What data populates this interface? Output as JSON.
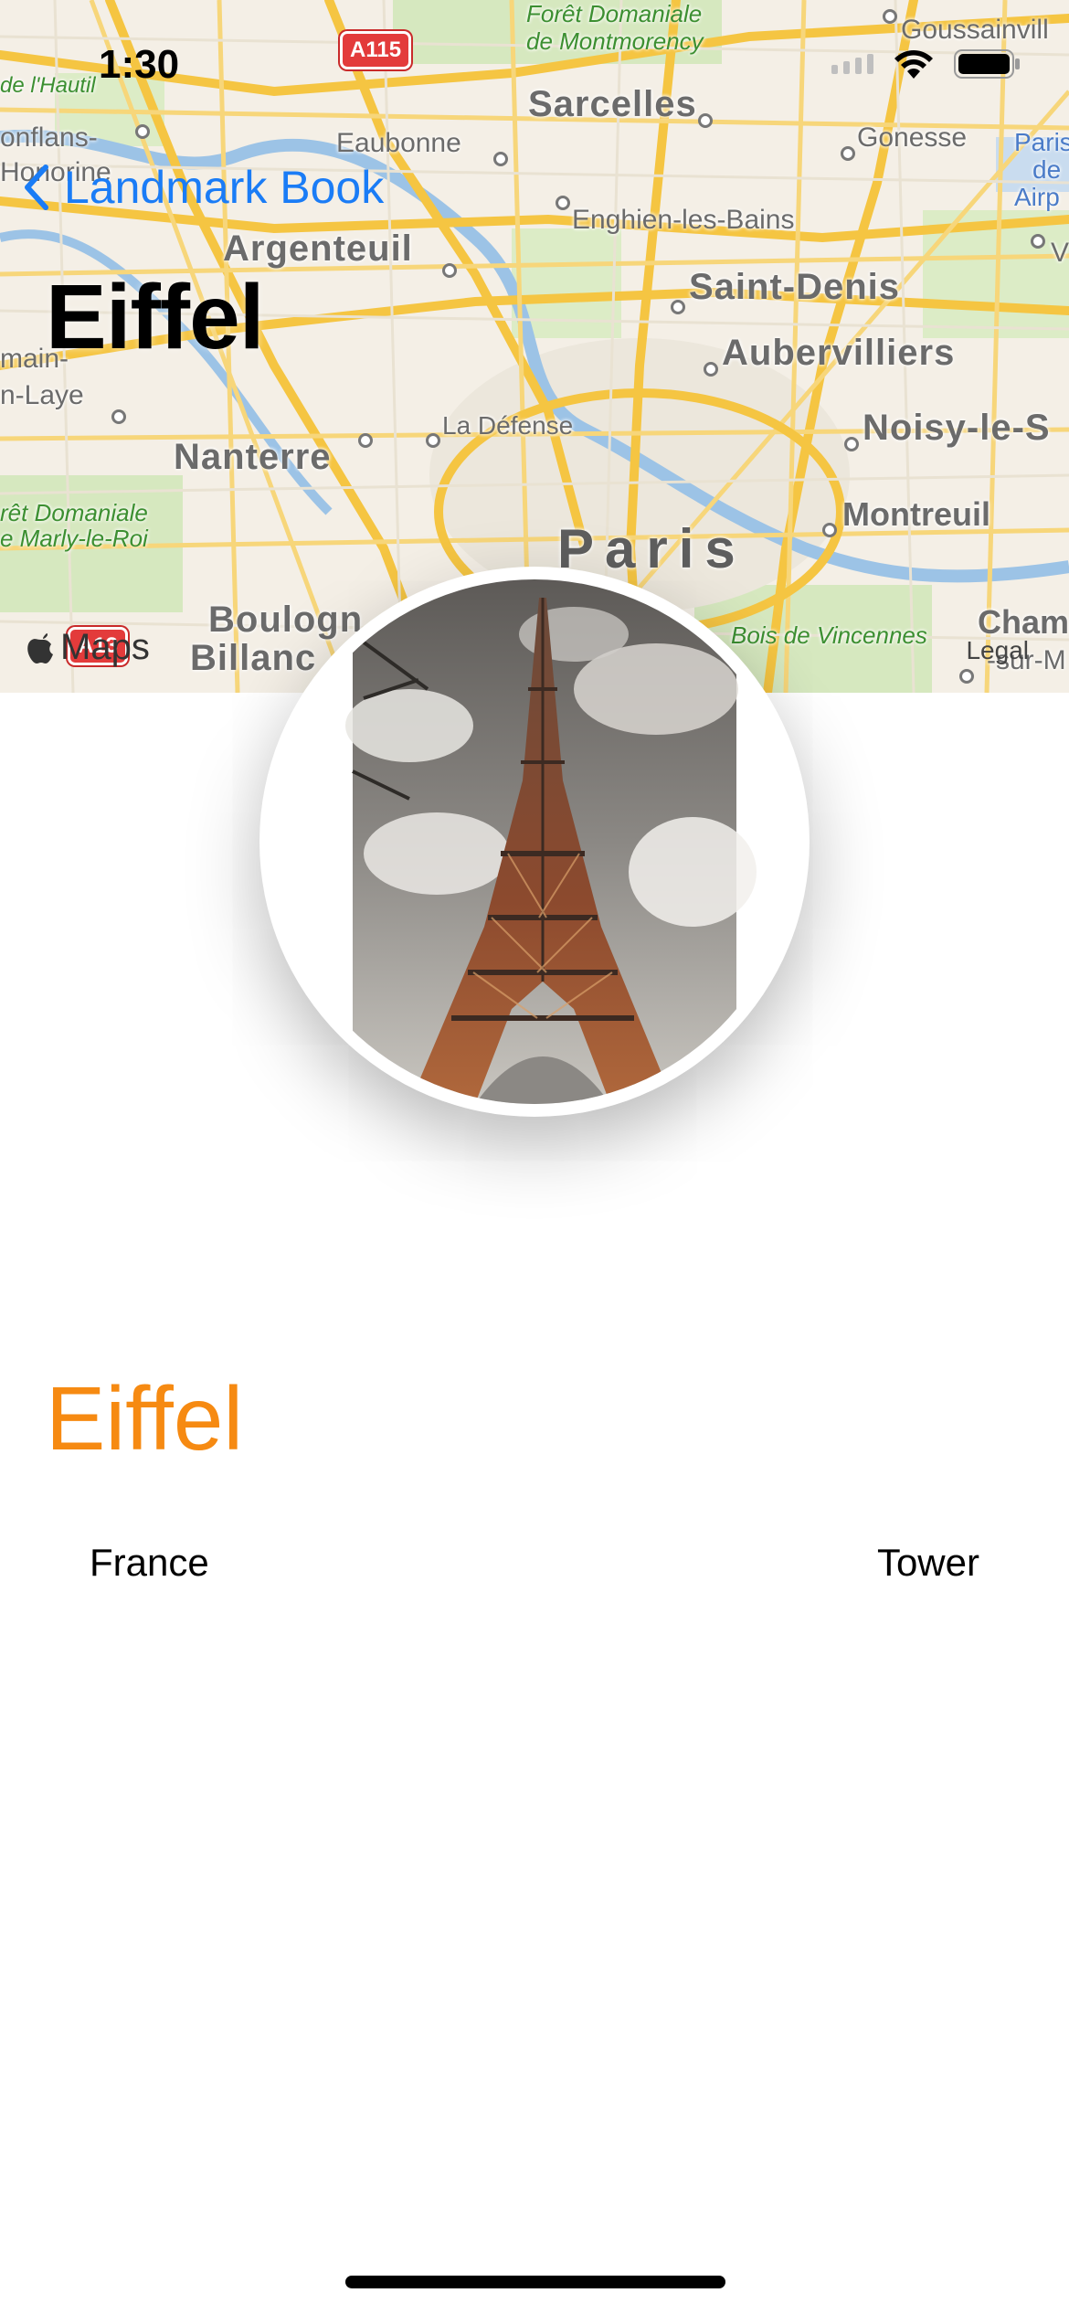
{
  "status_bar": {
    "time": "1:30"
  },
  "nav": {
    "back_label": "Landmark Book",
    "title": "Eiffel"
  },
  "map": {
    "attribution": "Maps",
    "legal": "Legal",
    "labels": {
      "foret_montmorency_1": "Forêt Domaniale",
      "foret_montmorency_2": "de Montmorency",
      "goussainville": "Goussainvill",
      "lhautil": "de l'Hautil",
      "sarcelles": "Sarcelles",
      "conflans": "onflans-",
      "honorine": "Honorine",
      "eaubonne": "Eaubonne",
      "gonesse": "Gonesse",
      "paris_cdg_1": "Paris",
      "paris_cdg_2": "de",
      "paris_cdg_3": "Airp",
      "enghien": "Enghien-les-Bains",
      "argenteuil": "Argenteuil",
      "saint_denis": "Saint-Denis",
      "v_right": "V",
      "main": "main-",
      "aubervilliers": "Aubervilliers",
      "laye": "n-Laye",
      "la_defense": "La Défense",
      "noisy": "Noisy-le-S",
      "nanterre": "Nanterre",
      "foret_marly_1": "rêt Domaniale",
      "foret_marly_2": "e Marly-le-Roi",
      "montreuil": "Montreuil",
      "paris": "Paris",
      "boulogne_1": "Boulogn",
      "boulogne_2": "Billanc",
      "bois_vincennes": "Bois de Vincennes",
      "cham_1": "Cham",
      "cham_2": "-sur-M"
    },
    "shields": {
      "a115": "A115",
      "a13": "A13"
    },
    "colors": {
      "land": "#f4efe6",
      "road": "#f5c542",
      "water": "#9cc3e6",
      "park": "#cfe5b4"
    }
  },
  "photo": {
    "subject": "Eiffel Tower photograph"
  },
  "landmark": {
    "name": "Eiffel",
    "country": "France",
    "type": "Tower",
    "accent_color": "#f68a12"
  }
}
